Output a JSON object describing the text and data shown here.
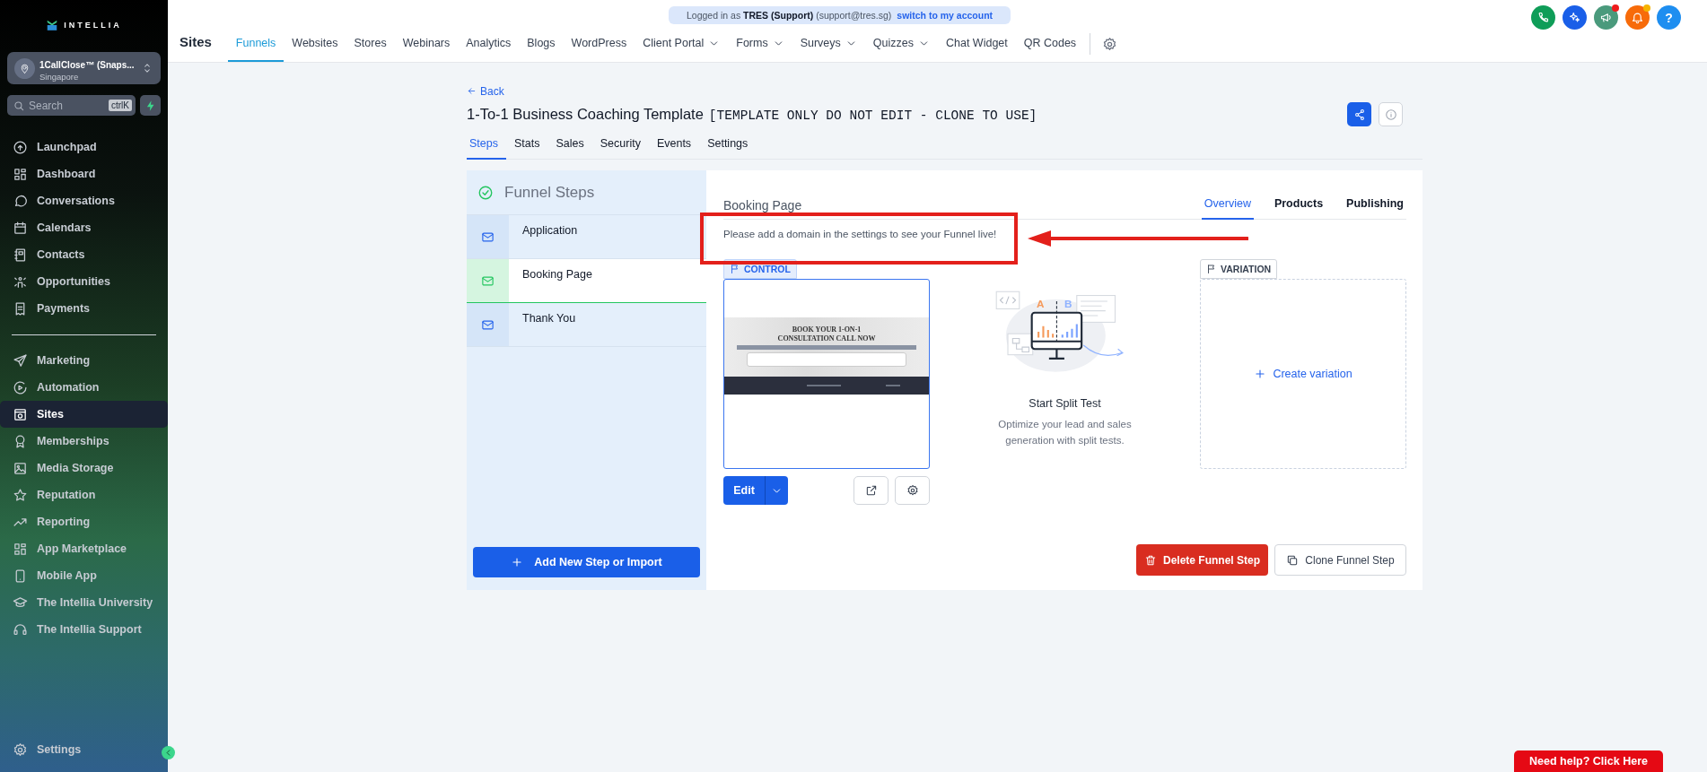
{
  "sidebar": {
    "logo": "INTELLIA",
    "account": {
      "name": "1CallClose™ (Snaps...",
      "location": "Singapore"
    },
    "search": {
      "placeholder": "Search",
      "shortcut": "ctrlK"
    },
    "groups": [
      [
        {
          "label": "Launchpad",
          "selected": false
        },
        {
          "label": "Dashboard",
          "selected": false
        },
        {
          "label": "Conversations",
          "selected": false
        },
        {
          "label": "Calendars",
          "selected": false
        },
        {
          "label": "Contacts",
          "selected": false
        },
        {
          "label": "Opportunities",
          "selected": false
        },
        {
          "label": "Payments",
          "selected": false
        }
      ],
      [
        {
          "label": "Marketing",
          "selected": false
        },
        {
          "label": "Automation",
          "selected": false
        },
        {
          "label": "Sites",
          "selected": true
        },
        {
          "label": "Memberships",
          "selected": false
        },
        {
          "label": "Media Storage",
          "selected": false
        },
        {
          "label": "Reputation",
          "selected": false
        },
        {
          "label": "Reporting",
          "selected": false
        },
        {
          "label": "App Marketplace",
          "selected": false
        },
        {
          "label": "Mobile App",
          "selected": false
        },
        {
          "label": "The Intellia University",
          "selected": false
        },
        {
          "label": "The Intellia Support",
          "selected": false
        }
      ]
    ],
    "settings": "Settings"
  },
  "login_banner": {
    "text": "Logged in as **TRES (Support)** (support@tres.sg)",
    "link": "switch to my account"
  },
  "header_buttons": [
    {
      "kind": "phone"
    },
    {
      "kind": "sparkle"
    },
    {
      "kind": "megaphone",
      "color": "#ee1c1c"
    },
    {
      "kind": "bell",
      "color": "#f5b301"
    },
    {
      "kind": "help",
      "label": "?"
    }
  ],
  "top_nav": {
    "title": "Sites",
    "items": [
      {
        "label": "Funnels",
        "selected": true,
        "dropdown": false
      },
      {
        "label": "Websites",
        "selected": false,
        "dropdown": false
      },
      {
        "label": "Stores",
        "selected": false,
        "dropdown": false
      },
      {
        "label": "Webinars",
        "selected": false,
        "dropdown": false
      },
      {
        "label": "Analytics",
        "selected": false,
        "dropdown": false
      },
      {
        "label": "Blogs",
        "selected": false,
        "dropdown": false
      },
      {
        "label": "WordPress",
        "selected": false,
        "dropdown": false
      },
      {
        "label": "Client Portal",
        "selected": false,
        "dropdown": true
      },
      {
        "label": "Forms",
        "selected": false,
        "dropdown": true
      },
      {
        "label": "Surveys",
        "selected": false,
        "dropdown": true
      },
      {
        "label": "Quizzes",
        "selected": false,
        "dropdown": true
      },
      {
        "label": "Chat Widget",
        "selected": false,
        "dropdown": false
      },
      {
        "label": "QR Codes",
        "selected": false,
        "dropdown": false
      }
    ]
  },
  "page": {
    "back": "Back",
    "title": "1-To-1 Business Coaching Template",
    "title_note": "[TEMPLATE ONLY DO NOT EDIT - CLONE TO USE]",
    "tabs": [
      {
        "label": "Steps",
        "selected": true
      },
      {
        "label": "Stats",
        "selected": false
      },
      {
        "label": "Sales",
        "selected": false
      },
      {
        "label": "Security",
        "selected": false
      },
      {
        "label": "Events",
        "selected": false
      },
      {
        "label": "Settings",
        "selected": false
      }
    ]
  },
  "funnel_steps": {
    "title": "Funnel Steps",
    "steps": [
      {
        "name": "Application",
        "selected": false
      },
      {
        "name": "Booking Page",
        "selected": true
      },
      {
        "name": "Thank You",
        "selected": false
      }
    ],
    "add_button": "Add New Step or Import"
  },
  "step_detail": {
    "title": "Booking Page",
    "tabs": [
      {
        "label": "Overview",
        "selected": true
      },
      {
        "label": "Products",
        "selected": false
      },
      {
        "label": "Publishing",
        "selected": false
      }
    ],
    "notice": "Please add a domain in the settings to see your Funnel live!",
    "control": {
      "label": "CONTROL",
      "preview_heading": "BOOK YOUR 1-ON-1 CONSULTATION CALL NOW",
      "edit": "Edit"
    },
    "split_test": {
      "variant_labels": [
        "A",
        "B"
      ],
      "title": "Start Split Test",
      "description": "Optimize your lead and sales generation with split tests."
    },
    "variation": {
      "label": "VARIATION",
      "create": "Create variation"
    },
    "delete": "Delete Funnel Step",
    "clone": "Clone Funnel Step"
  },
  "help_button": "Need help? Click Here"
}
